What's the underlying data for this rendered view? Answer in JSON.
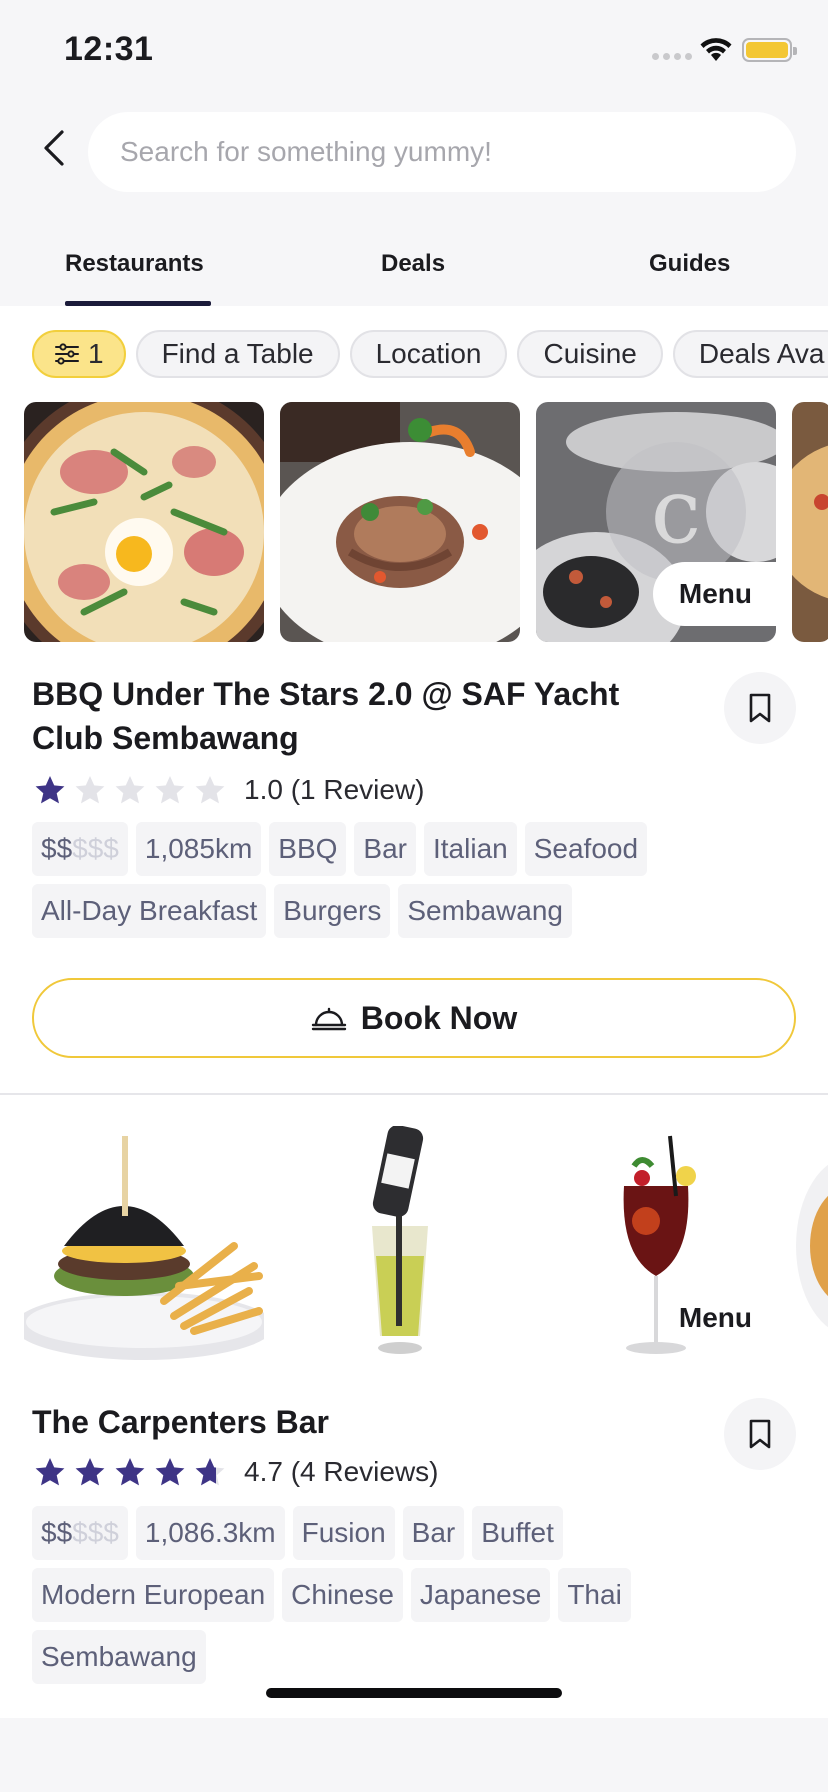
{
  "status_bar": {
    "time": "12:31",
    "battery_level": 0.85,
    "battery_color": "#f3c734"
  },
  "search": {
    "placeholder": "Search for something yummy!",
    "value": ""
  },
  "tabs": [
    {
      "label": "Restaurants",
      "active": true
    },
    {
      "label": "Deals",
      "active": false
    },
    {
      "label": "Guides",
      "active": false
    }
  ],
  "filters": {
    "active_count": "1",
    "chips": [
      "Find a Table",
      "Location",
      "Cuisine",
      "Deals Ava"
    ]
  },
  "colors": {
    "accent_yellow": "#f2cf3c",
    "star_filled": "#3e3486",
    "star_empty": "#e3e3e8",
    "tag_text": "#5d6079"
  },
  "restaurants": [
    {
      "name": "BBQ Under The Stars 2.0 @ SAF Yacht Club Sembawang",
      "rating": 1.0,
      "rating_text": "1.0 (1 Review)",
      "price_active": "$$",
      "price_inactive": "$$$",
      "tags": [
        "1,085km",
        "BBQ",
        "Bar",
        "Italian",
        "Seafood",
        "All-Day Breakfast",
        "Burgers",
        "Sembawang"
      ],
      "menu_label": "Menu",
      "book_label": "Book Now",
      "photos": [
        "pizza-photo",
        "grilled-dish-photo",
        "squid-ink-pasta-photo",
        "pizza-partial-photo"
      ]
    },
    {
      "name": "The Carpenters Bar",
      "rating": 4.7,
      "rating_text": "4.7 (4 Reviews)",
      "price_active": "$$",
      "price_inactive": "$$$",
      "tags": [
        "1,086.3km",
        "Fusion",
        "Bar",
        "Buffet",
        "Modern European",
        "Chinese",
        "Japanese",
        "Thai",
        "Sembawang"
      ],
      "menu_label": "Menu",
      "photos": [
        "charcoal-burger-photo",
        "beer-tower-photo",
        "sangria-photo",
        "waffle-partial-photo"
      ]
    }
  ]
}
